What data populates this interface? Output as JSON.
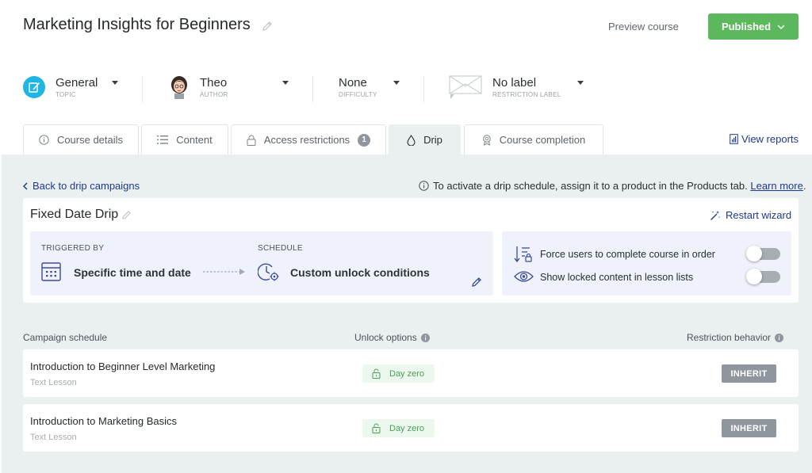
{
  "header": {
    "title": "Marketing Insights for Beginners",
    "preview_label": "Preview course",
    "publish_label": "Published"
  },
  "meta": {
    "topic": {
      "value": "General",
      "label": "TOPIC"
    },
    "author": {
      "value": "Theo",
      "label": "AUTHOR"
    },
    "difficulty": {
      "value": "None",
      "label": "DIFFICULTY"
    },
    "restriction": {
      "value": "No label",
      "label": "RESTRICTION LABEL"
    }
  },
  "tabs": {
    "course_details": "Course details",
    "content": "Content",
    "access_restrictions": "Access restrictions",
    "access_badge": "1",
    "drip": "Drip",
    "course_completion": "Course completion"
  },
  "view_reports": "View reports",
  "drip": {
    "back_label": "Back to drip campaigns",
    "note_text": "To activate a drip schedule, assign it to a product in the Products tab.",
    "note_link": "Learn more",
    "note_end": ".",
    "campaign_title": "Fixed Date Drip",
    "restart_label": "Restart wizard",
    "triggered_label": "TRIGGERED BY",
    "triggered_value": "Specific time and date",
    "schedule_label": "SCHEDULE",
    "schedule_value": "Custom unlock conditions",
    "options": [
      {
        "label": "Force users to complete course in order",
        "enabled": false
      },
      {
        "label": "Show locked content in lesson lists",
        "enabled": false
      }
    ]
  },
  "schedule": {
    "columns": {
      "campaign": "Campaign schedule",
      "unlock": "Unlock options",
      "restriction": "Restriction behavior"
    },
    "rows": [
      {
        "title": "Introduction to Beginner Level Marketing",
        "type": "Text Lesson",
        "unlock": "Day zero",
        "behavior": "INHERIT"
      },
      {
        "title": "Introduction to Marketing Basics",
        "type": "Text Lesson",
        "unlock": "Day zero",
        "behavior": "INHERIT"
      }
    ]
  },
  "colors": {
    "published": "#5cb85c",
    "link": "#1d3a8f",
    "panel_bg": "#eaeff0",
    "option_bg": "#eff1fb",
    "unlock_green": "#4a9e57",
    "inherit_grey": "#8f969d",
    "topic_icon_bg": "#1fb6e6"
  },
  "icons": {
    "title_edit": "pencil-icon",
    "publish_caret": "chevron-down-icon",
    "topic": "edit-document-icon",
    "author": "avatar-icon",
    "restriction": "envelope-label-icon",
    "course_details": "info-icon",
    "content": "list-icon",
    "access_restrictions": "lock-icon",
    "drip": "drop-icon",
    "course_completion": "award-icon",
    "view_reports": "report-icon",
    "back": "chevron-left-icon",
    "note": "info-icon",
    "restart": "magic-wand-icon",
    "triggered": "calendar-icon",
    "schedule": "clock-gear-icon",
    "edit": "pencil-icon",
    "force_order": "sort-lock-icon",
    "show_locked": "eye-icon",
    "unlock": "unlock-icon",
    "help": "info-filled-icon"
  }
}
